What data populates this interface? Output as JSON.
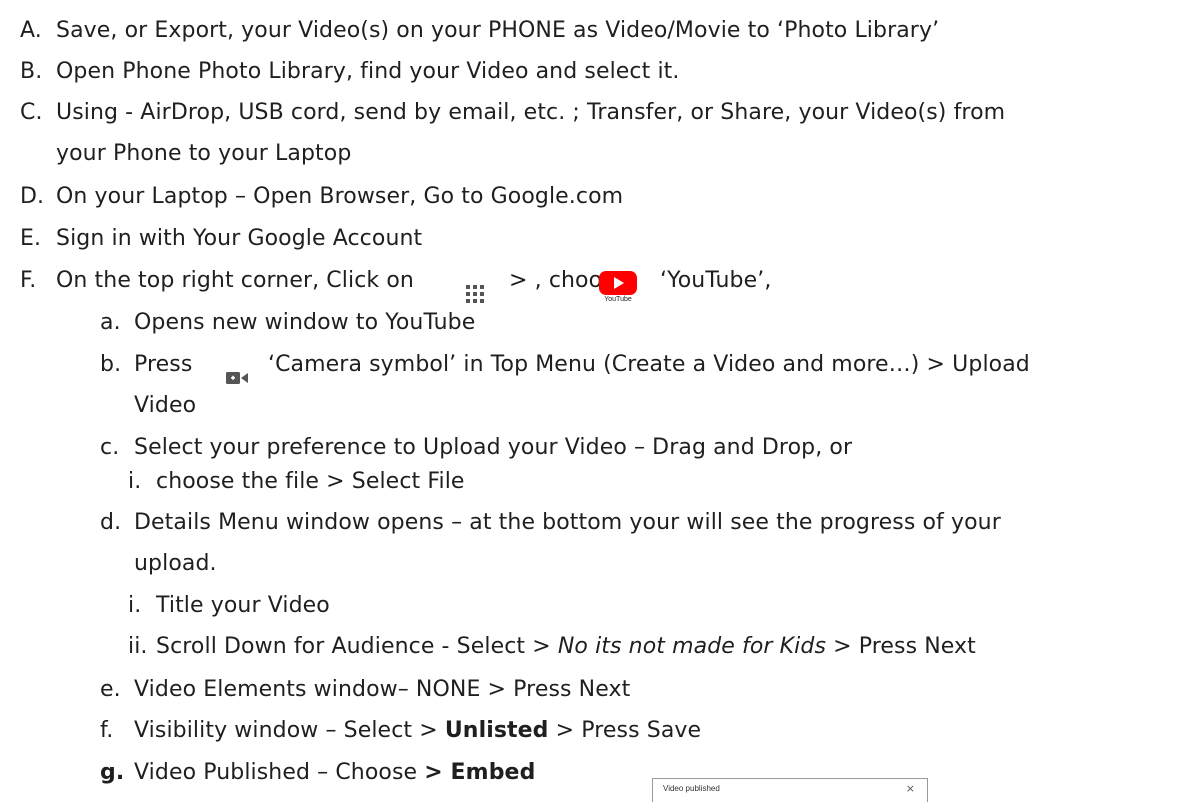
{
  "steps": [
    {
      "marker": "A.",
      "text": "Save, or Export, your Video(s) on your PHONE as Video/Movie to ‘Photo Library’"
    },
    {
      "marker": "B.",
      "text": "Open Phone Photo Library, find your Video and select it."
    },
    {
      "marker": "C.",
      "text": "Using - AirDrop, USB cord, send by email, etc. ; Transfer, or Share, your Video(s) from",
      "text2": "your Phone to your Laptop"
    },
    {
      "marker": "D.",
      "text": "On your Laptop – Open Browser, Go to Google.com"
    },
    {
      "marker": "E.",
      "text": "Sign in with Your Google Account"
    },
    {
      "marker": "F.",
      "text_a": "On the top right corner, Click on",
      "text_b": "> , choose",
      "text_c": "‘YouTube’,",
      "youtube_caption": "YouTube"
    }
  ],
  "substeps": {
    "a": {
      "marker": "a.",
      "text": "Opens new window to YouTube"
    },
    "b": {
      "marker": "b.",
      "text_a": "Press",
      "text_b": "‘Camera symbol’ in Top Menu (Create a Video and more…) > Upload",
      "text2": "Video"
    },
    "c": {
      "marker": "c.",
      "text": "Select your preference to Upload your Video – Drag and Drop, or"
    },
    "c_i": {
      "marker": "i.",
      "text": "choose the file > Select File"
    },
    "d": {
      "marker": "d.",
      "text": "Details Menu window opens – at the bottom your will see the progress of your",
      "text2": "upload."
    },
    "d_i": {
      "marker": "i.",
      "text": "Title your Video"
    },
    "d_ii": {
      "marker": "ii.",
      "text_a": "Scroll Down for Audience - Select >",
      "text_italic": "No its not made for Kids",
      "text_b": "> Press Next"
    },
    "e": {
      "marker": "e.",
      "text": "Video Elements window– NONE > Press Next"
    },
    "f": {
      "marker": "f.",
      "text_a": "Visibility window – Select >",
      "text_bold": "Unlisted",
      "text_b": "> Press Save"
    },
    "g": {
      "marker": "g.",
      "text_a": "Video Published – Choose",
      "text_bold": "> Embed"
    }
  },
  "thumbnail": {
    "title": "Video published",
    "close": "×"
  },
  "colors": {
    "text": "#1f1f1f",
    "youtube_red": "#ff0000",
    "icon_gray": "#555555"
  }
}
